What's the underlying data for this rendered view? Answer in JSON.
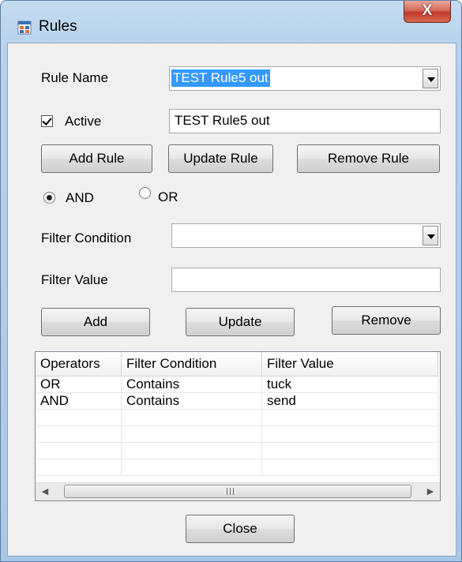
{
  "window": {
    "title": "Rules",
    "close_label": "X"
  },
  "rule": {
    "name_label": "Rule Name",
    "name_value": "TEST Rule5 out",
    "active_label": "Active",
    "active_checked": true,
    "active_value": "TEST Rule5 out"
  },
  "buttons": {
    "add_rule": "Add Rule",
    "update_rule": "Update Rule",
    "remove_rule": "Remove Rule",
    "add": "Add",
    "update": "Update",
    "remove": "Remove",
    "close": "Close"
  },
  "logic": {
    "and_label": "AND",
    "or_label": "OR",
    "selected": "AND"
  },
  "filter": {
    "condition_label": "Filter Condition",
    "condition_value": "",
    "value_label": "Filter Value",
    "value_value": ""
  },
  "grid": {
    "columns": [
      "Operators",
      "Filter Condition",
      "Filter Value"
    ],
    "rows": [
      [
        "OR",
        "Contains",
        "tuck"
      ],
      [
        "AND",
        "Contains",
        "send"
      ]
    ]
  },
  "icons": {
    "app": "form-window-icon",
    "scroll_left": "arrow-left-icon",
    "scroll_right": "arrow-right-icon"
  }
}
